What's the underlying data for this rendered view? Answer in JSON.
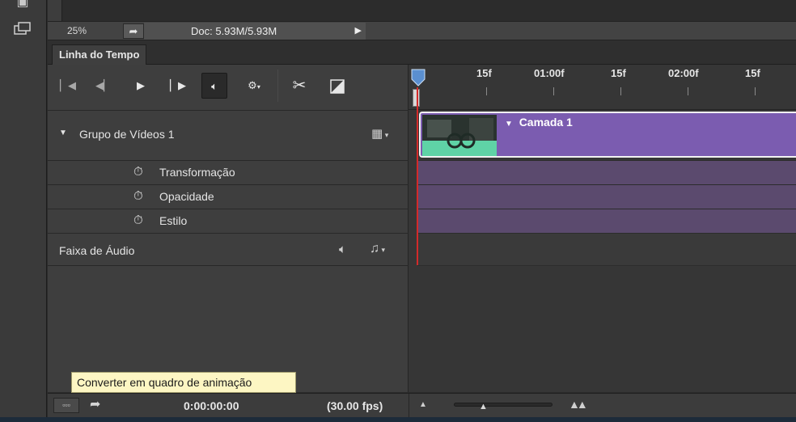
{
  "status": {
    "zoom": "25%",
    "doc": "Doc: 5.93M/5.93M"
  },
  "panel": {
    "tab_label": "Linha do Tempo"
  },
  "ruler": {
    "ticks": [
      "15f",
      "01:00f",
      "15f",
      "02:00f",
      "15f"
    ]
  },
  "tracks": {
    "group_name": "Grupo de Vídeos 1",
    "properties": [
      "Transformação",
      "Opacidade",
      "Estilo"
    ],
    "audio_name": "Faixa de Áudio",
    "clip_name": "Camada 1"
  },
  "tooltip": "Converter em quadro de animação",
  "footer": {
    "time": "0:00:00:00",
    "fps": "(30.00 fps)"
  },
  "colors": {
    "clip": "#7b5cb0",
    "playhead": "#d32a2a",
    "tooltip": "#fdf6c3"
  }
}
